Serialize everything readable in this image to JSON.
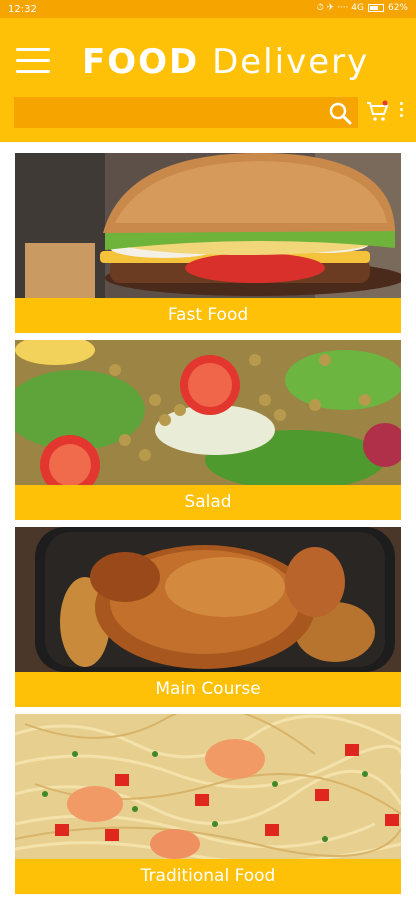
{
  "status_bar": {
    "time": "12:32",
    "indicators": "⏱ ✈ ···· 4G",
    "battery": "62%"
  },
  "app_bar": {
    "title_bold": "FOOD",
    "title_rest": "Delivery",
    "search": {
      "value": "",
      "placeholder": ""
    }
  },
  "colors": {
    "primary": "#ffc107",
    "primary_dark": "#f6a400",
    "label_text": "#ffffff"
  },
  "categories": [
    {
      "label": "Fast Food",
      "icon": "burger-image"
    },
    {
      "label": "Salad",
      "icon": "salad-image"
    },
    {
      "label": "Main Course",
      "icon": "roast-chicken-image"
    },
    {
      "label": "Traditional Food",
      "icon": "spaghetti-image"
    }
  ]
}
